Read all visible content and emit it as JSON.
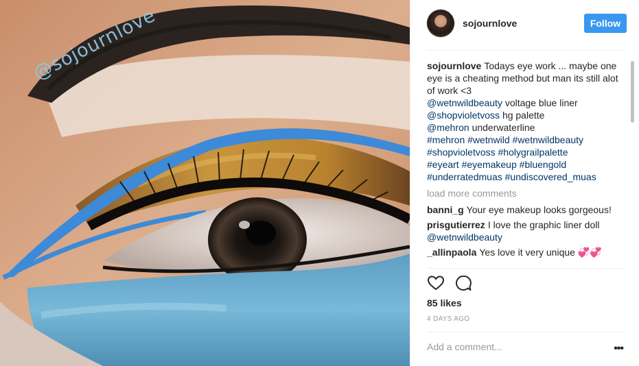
{
  "photo": {
    "watermark": "@sojournlove"
  },
  "header": {
    "username": "sojournlove",
    "follow_label": "Follow"
  },
  "caption": {
    "username": "sojournlove",
    "lines": [
      "Todays eye work ... maybe one eye is a cheating method but man its still alot of work <3"
    ],
    "credits": [
      {
        "tag": "@wetnwildbeauty",
        "text": "voltage blue liner"
      },
      {
        "tag": "@shopvioletvoss",
        "text": "hg palette"
      },
      {
        "tag": "@mehron",
        "text": "underwaterline"
      }
    ],
    "hashtags": [
      [
        "#mehron",
        "#wetnwild",
        "#wetnwildbeauty"
      ],
      [
        "#shopvioletvoss",
        "#holygrailpalette"
      ],
      [
        "#eyeart",
        "#eyemakeup",
        "#bluengold"
      ],
      [
        "#underratedmuas",
        "#undiscovered_muas"
      ]
    ]
  },
  "load_more": "load more comments",
  "comments": [
    {
      "username": "banni_g",
      "text": "Your eye makeup looks gorgeous!",
      "mention": ""
    },
    {
      "username": "prisgutierrez",
      "text": "I love the graphic liner doll",
      "mention": "@wetnwildbeauty"
    },
    {
      "username": "_allinpaola",
      "text": "Yes love it very unique 💞💞",
      "mention": ""
    }
  ],
  "icons": {
    "like": "heart-outline-icon",
    "comment": "comment-bubble-icon",
    "more": "more-options-icon"
  },
  "likes": "85 likes",
  "timestamp": "4 DAYS AGO",
  "add_comment_placeholder": "Add a comment...",
  "more_label": "•••",
  "colors": {
    "follow_bg": "#3897f0",
    "link": "#003569",
    "muted": "#999999"
  }
}
